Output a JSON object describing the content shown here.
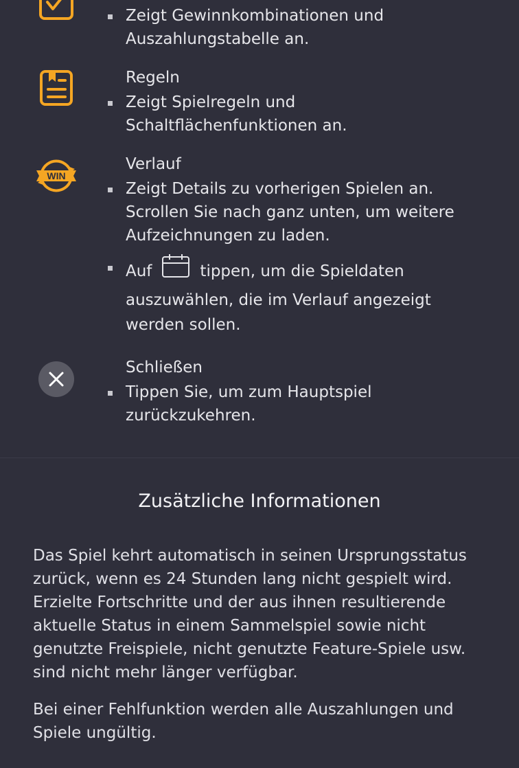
{
  "items": [
    {
      "icon": "paytable-icon",
      "bullets": [
        "Zeigt Gewinnkombinationen und Auszahlungstabelle an."
      ]
    },
    {
      "icon": "rules-icon",
      "title": "Regeln",
      "bullets": [
        "Zeigt Spielregeln und Schaltflächenfunktionen an."
      ]
    },
    {
      "icon": "history-win-icon",
      "title": "Verlauf",
      "bullets": [
        "Zeigt Details zu vorherigen Spielen an. Scrollen Sie nach ganz unten, um weitere Aufzeichnungen zu laden."
      ],
      "calendar_bullet": {
        "before": "Auf",
        "after": "tippen, um die Spieldaten auszuwählen, die im Verlauf angezeigt werden sollen."
      },
      "icon_word": "WIN"
    },
    {
      "icon": "close-icon",
      "title": "Schließen",
      "bullets": [
        "Tippen Sie, um zum Hauptspiel zurückzukehren."
      ]
    }
  ],
  "additional": {
    "title": "Zusätzliche Informationen",
    "paragraphs": [
      "Das Spiel kehrt automatisch in seinen Ursprungsstatus zurück, wenn es 24 Stunden lang nicht gespielt wird. Erzielte Fortschritte und der aus ihnen resultierende aktuelle Status in einem Sammelspiel sowie nicht genutzte Freispiele, nicht genutzte Feature-Spiele usw. sind nicht mehr länger verfügbar.",
      "Bei einer Fehlfunktion werden alle Auszahlungen und Spiele ungültig."
    ]
  },
  "colors": {
    "background": "#2f2f3b",
    "accent": "#f5a623",
    "close_bg": "#5a5a64"
  }
}
